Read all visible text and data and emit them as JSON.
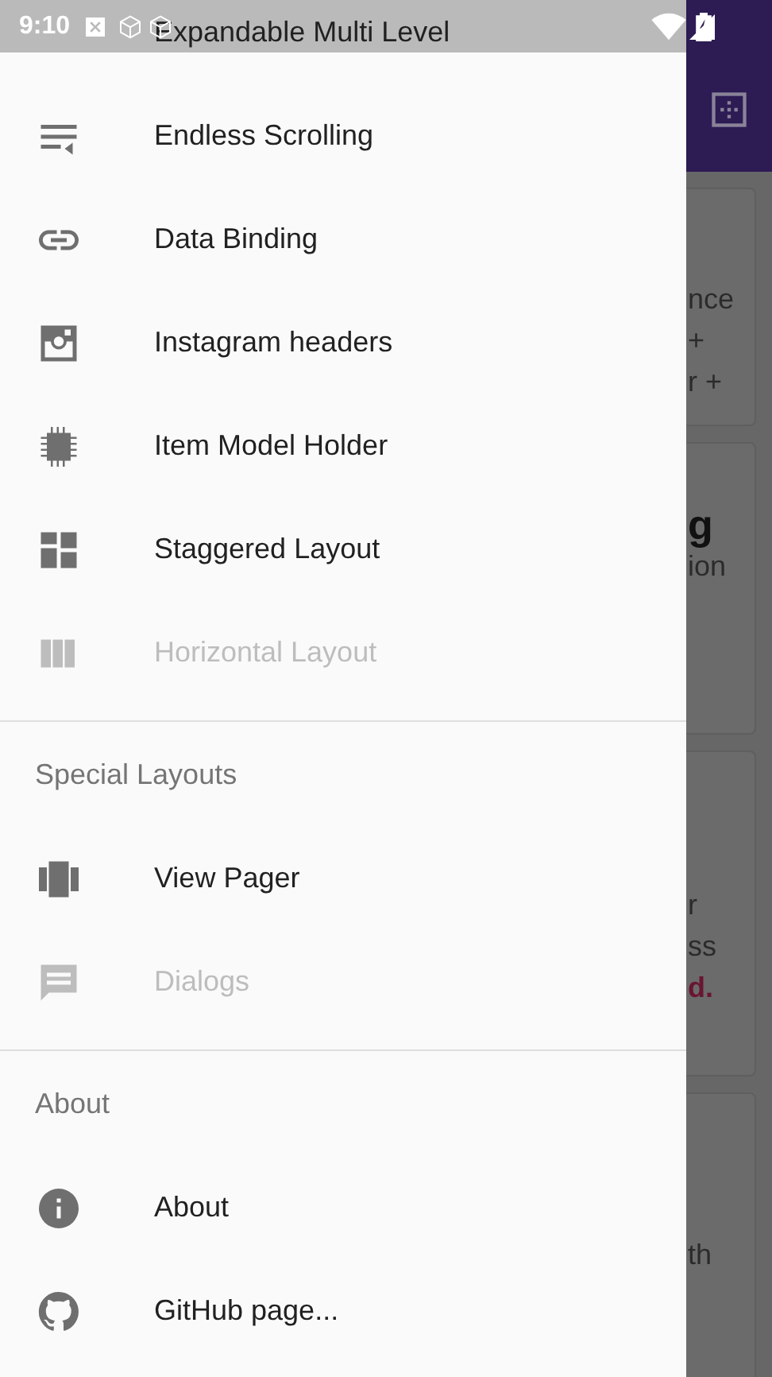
{
  "status_bar": {
    "time": "9:10"
  },
  "drawer": {
    "sections": [
      {
        "items": [
          {
            "label": "Expandable Multi Level",
            "disabled": false
          },
          {
            "label": "Endless Scrolling",
            "disabled": false
          },
          {
            "label": "Data Binding",
            "disabled": false
          },
          {
            "label": "Instagram headers",
            "disabled": false
          },
          {
            "label": "Item Model Holder",
            "disabled": false
          },
          {
            "label": "Staggered Layout",
            "disabled": false
          },
          {
            "label": "Horizontal Layout",
            "disabled": true
          }
        ]
      },
      {
        "header": "Special Layouts",
        "items": [
          {
            "label": "View Pager",
            "disabled": false
          },
          {
            "label": "Dialogs",
            "disabled": true
          }
        ]
      },
      {
        "header": "About",
        "items": [
          {
            "label": "About",
            "disabled": false
          },
          {
            "label": "GitHub page...",
            "disabled": false
          }
        ]
      }
    ]
  },
  "background_cards": [
    {
      "lines": [
        {
          "text": "nce",
          "kind": "body"
        },
        {
          "text": "+",
          "kind": "body"
        },
        {
          "text": "r +",
          "kind": "body"
        }
      ]
    },
    {
      "lines": [
        {
          "text": "g",
          "kind": "title"
        },
        {
          "text": "ion",
          "kind": "body"
        }
      ]
    },
    {
      "lines": [
        {
          "text": "r",
          "kind": "body"
        },
        {
          "text": "ss",
          "kind": "body"
        },
        {
          "text": "d.",
          "kind": "accent"
        }
      ]
    },
    {
      "lines": [
        {
          "text": "th",
          "kind": "body"
        }
      ]
    }
  ]
}
